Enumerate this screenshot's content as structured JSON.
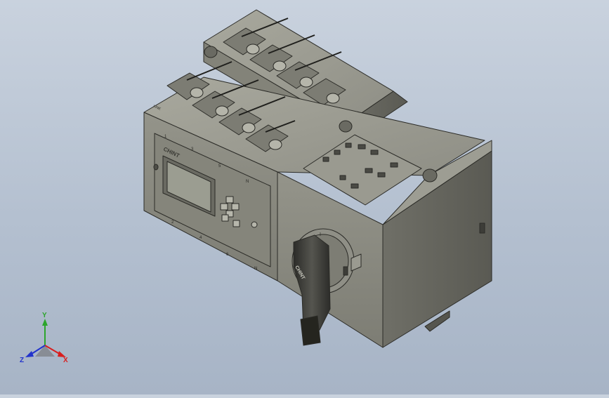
{
  "model": {
    "brand_text": "CHINT",
    "load_label": "LINE",
    "top_terminal_labels": [
      "1",
      "3",
      "5",
      "N"
    ],
    "bottom_terminal_labels": [
      "2",
      "4",
      "6",
      "N"
    ],
    "lcd_state": "blank",
    "handle_position": "I",
    "colors": {
      "body": "#8a8a80",
      "body_dark": "#5f5f57",
      "body_light": "#a7a79c",
      "edge": "#2b2b27",
      "background_top": "#c9d2de",
      "background_bottom": "#a7b4c6",
      "handle": "#3a3a36",
      "lcd": "#9b9d91"
    }
  },
  "triad": {
    "x_label": "X",
    "y_label": "Y",
    "z_label": "Z",
    "x_color": "#d81e1e",
    "y_color": "#2ca52c",
    "z_color": "#2233cc"
  }
}
